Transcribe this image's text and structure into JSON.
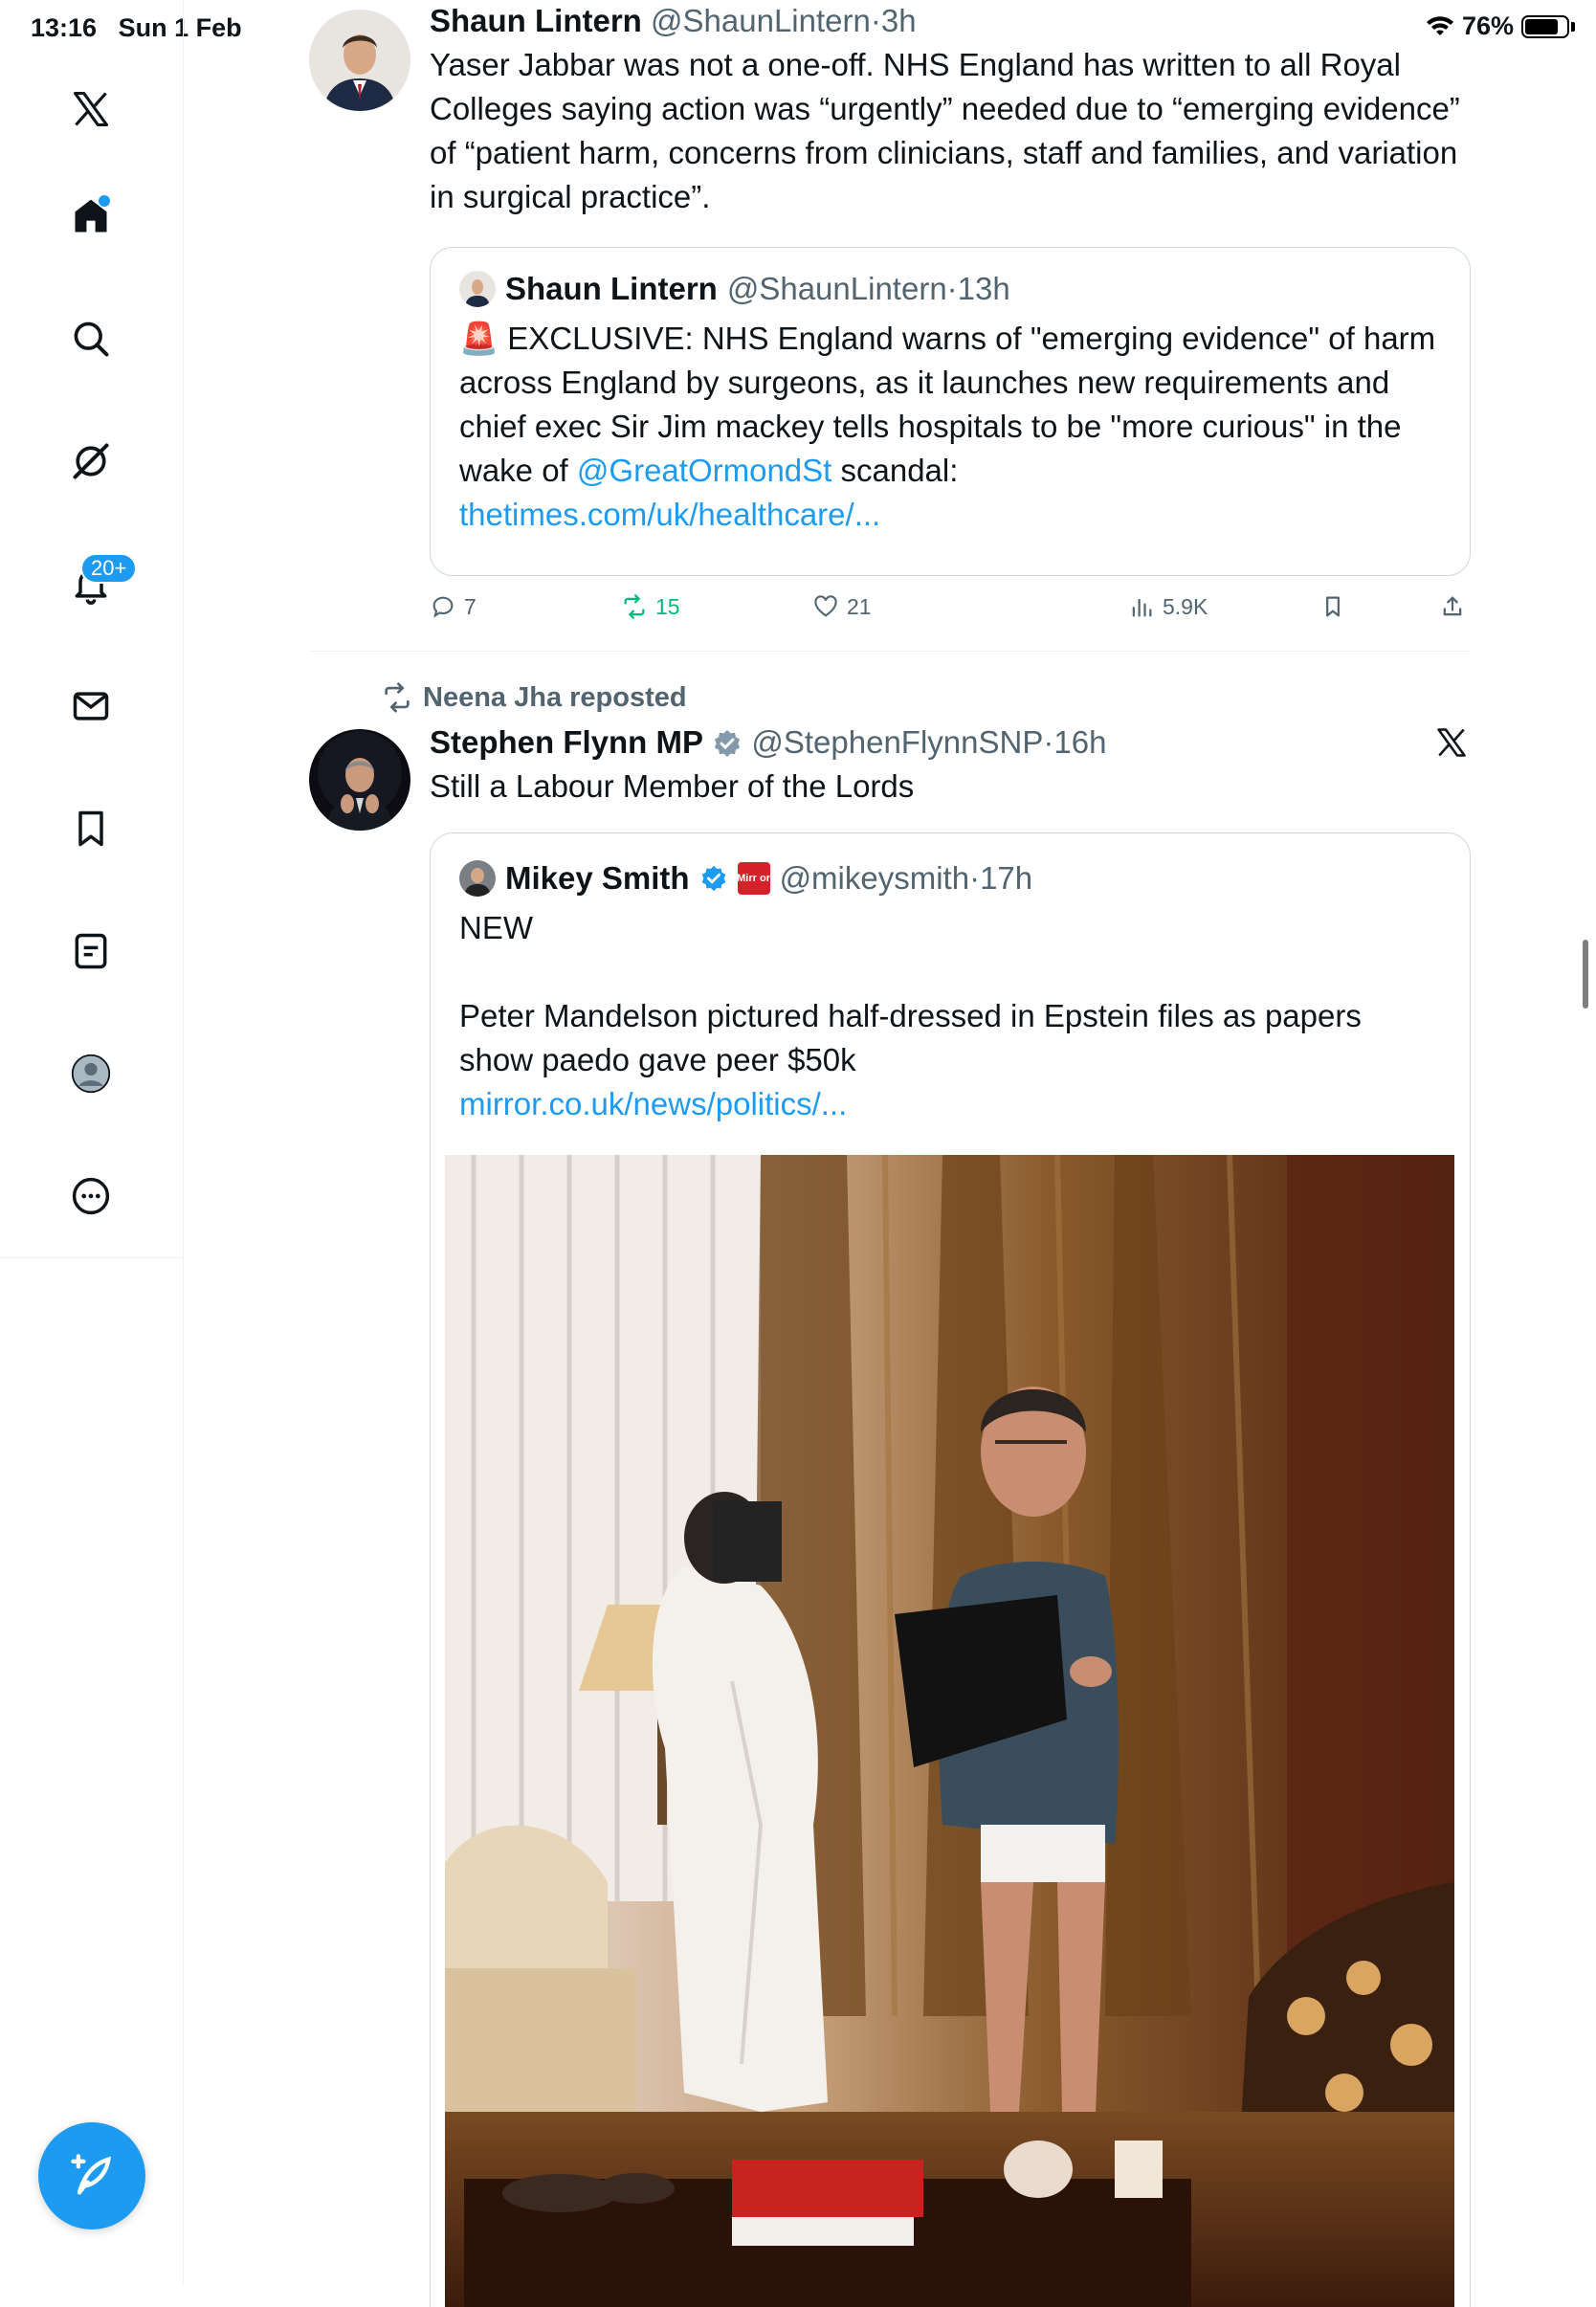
{
  "status_bar": {
    "time": "13:16",
    "date": "Sun 1 Feb",
    "battery": "76%"
  },
  "sidebar": {
    "items": [
      {
        "name": "x-logo"
      },
      {
        "name": "home"
      },
      {
        "name": "explore"
      },
      {
        "name": "grok"
      },
      {
        "name": "notifications",
        "badge": "20+"
      },
      {
        "name": "messages"
      },
      {
        "name": "bookmarks"
      },
      {
        "name": "lists"
      },
      {
        "name": "profile"
      },
      {
        "name": "more"
      }
    ]
  },
  "tweets": [
    {
      "author": "Shaun Lintern",
      "handle": "@ShaunLintern",
      "time": "3h",
      "text": "Yaser Jabbar was not a one-off. NHS England has written to all Royal Colleges saying action was “urgently” needed due to “emerging evidence” of “patient harm, concerns from clinicians, staff and families, and variation in surgical practice”.",
      "quote": {
        "author": "Shaun Lintern",
        "handle": "@ShaunLintern",
        "time": "13h",
        "text_before": "🚨 EXCLUSIVE: NHS England warns of \"emerging evidence\" of harm across England by surgeons, as it launches new requirements and chief exec Sir Jim mackey tells hospitals to be \"more curious\" in the wake of ",
        "mention": "@GreatOrmondSt",
        "text_after": " scandal:",
        "link": "thetimes.com/uk/healthcare/..."
      },
      "actions": {
        "replies": "7",
        "reposts": "15",
        "likes": "21",
        "views": "5.9K"
      }
    },
    {
      "repost_by": "Neena Jha reposted",
      "author": "Stephen Flynn MP",
      "handle": "@StephenFlynnSNP",
      "time": "16h",
      "text": "Still a Labour Member of the Lords",
      "quote": {
        "author": "Mikey Smith",
        "handle": "@mikeysmith",
        "time": "17h",
        "badge_text": "Mirr or",
        "line1": "NEW",
        "line2": "Peter Mandelson pictured half-dressed in Epstein files as papers show paedo gave peer $50k",
        "link": "mirror.co.uk/news/politics/..."
      }
    }
  ],
  "colors": {
    "accent": "#1d9bf0",
    "repost_green": "#00ba7c",
    "muted": "#536471"
  }
}
